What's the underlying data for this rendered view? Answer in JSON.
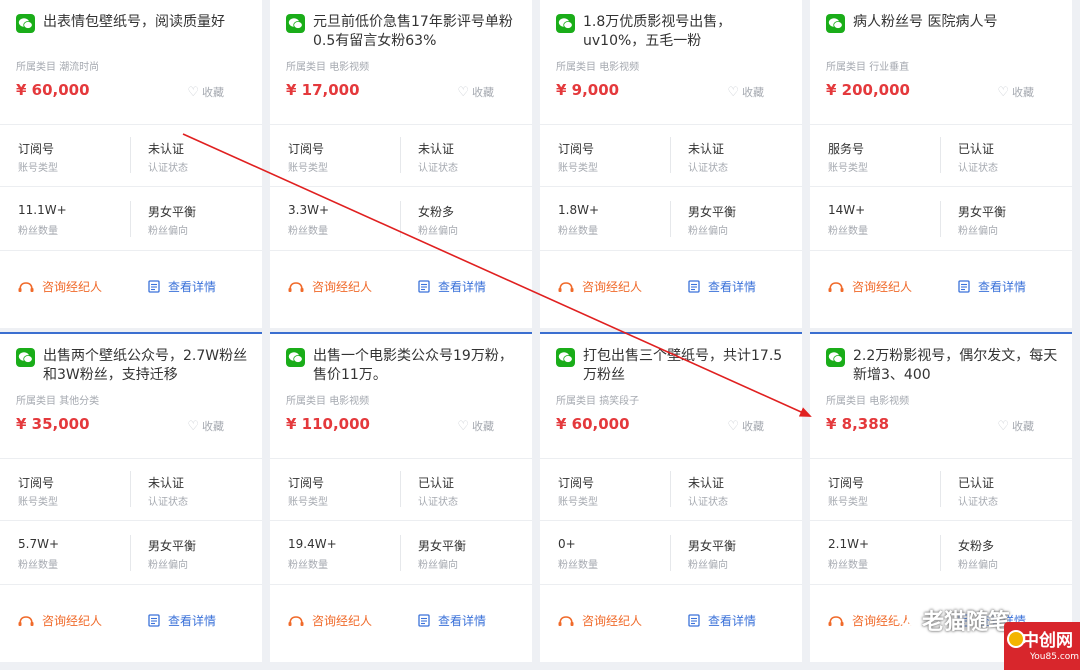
{
  "labels": {
    "category_prefix": "所属类目",
    "account_type_label": "账号类型",
    "auth_label": "认证状态",
    "fans_label": "粉丝数量",
    "gender_label": "粉丝偏向",
    "favorite": "收藏",
    "consult": "咨询经纪人",
    "detail": "查看详情"
  },
  "cards": [
    {
      "title": "出表情包壁纸号，阅读质量好",
      "category": "潮流时尚",
      "price": "¥ 60,000",
      "account_type": "订阅号",
      "auth": "未认证",
      "fans": "11.1W+",
      "gender": "男女平衡"
    },
    {
      "title": "元旦前低价急售17年影评号单粉0.5有留言女粉63%",
      "category": "电影视频",
      "price": "¥ 17,000",
      "account_type": "订阅号",
      "auth": "未认证",
      "fans": "3.3W+",
      "gender": "女粉多"
    },
    {
      "title": "1.8万优质影视号出售，uv10%，五毛一粉",
      "category": "电影视频",
      "price": "¥ 9,000",
      "account_type": "订阅号",
      "auth": "未认证",
      "fans": "1.8W+",
      "gender": "男女平衡"
    },
    {
      "title": "病人粉丝号 医院病人号",
      "category": "行业垂直",
      "price": "¥ 200,000",
      "account_type": "服务号",
      "auth": "已认证",
      "fans": "14W+",
      "gender": "男女平衡"
    },
    {
      "title": "出售两个壁纸公众号，2.7W粉丝和3W粉丝，支持迁移",
      "category": "其他分类",
      "price": "¥ 35,000",
      "account_type": "订阅号",
      "auth": "未认证",
      "fans": "5.7W+",
      "gender": "男女平衡"
    },
    {
      "title": "出售一个电影类公众号19万粉，售价11万。",
      "category": "电影视频",
      "price": "¥ 110,000",
      "account_type": "订阅号",
      "auth": "已认证",
      "fans": "19.4W+",
      "gender": "男女平衡"
    },
    {
      "title": "打包出售三个壁纸号，共计17.5万粉丝",
      "category": "搞笑段子",
      "price": "¥ 60,000",
      "account_type": "订阅号",
      "auth": "未认证",
      "fans": "0+",
      "gender": "男女平衡"
    },
    {
      "title": "2.2万粉影视号，偶尔发文，每天新增3、400",
      "category": "电影视频",
      "price": "¥ 8,388",
      "account_type": "订阅号",
      "auth": "已认证",
      "fans": "2.1W+",
      "gender": "女粉多"
    }
  ],
  "watermark": "老猫随笔",
  "logo": {
    "cn": "中创网",
    "en": "You85.com"
  },
  "colors": {
    "price": "#e4393c",
    "consult": "#f06a2a",
    "detail": "#3b72d9",
    "wechat": "#1aad19",
    "arrow": "#e02020"
  }
}
